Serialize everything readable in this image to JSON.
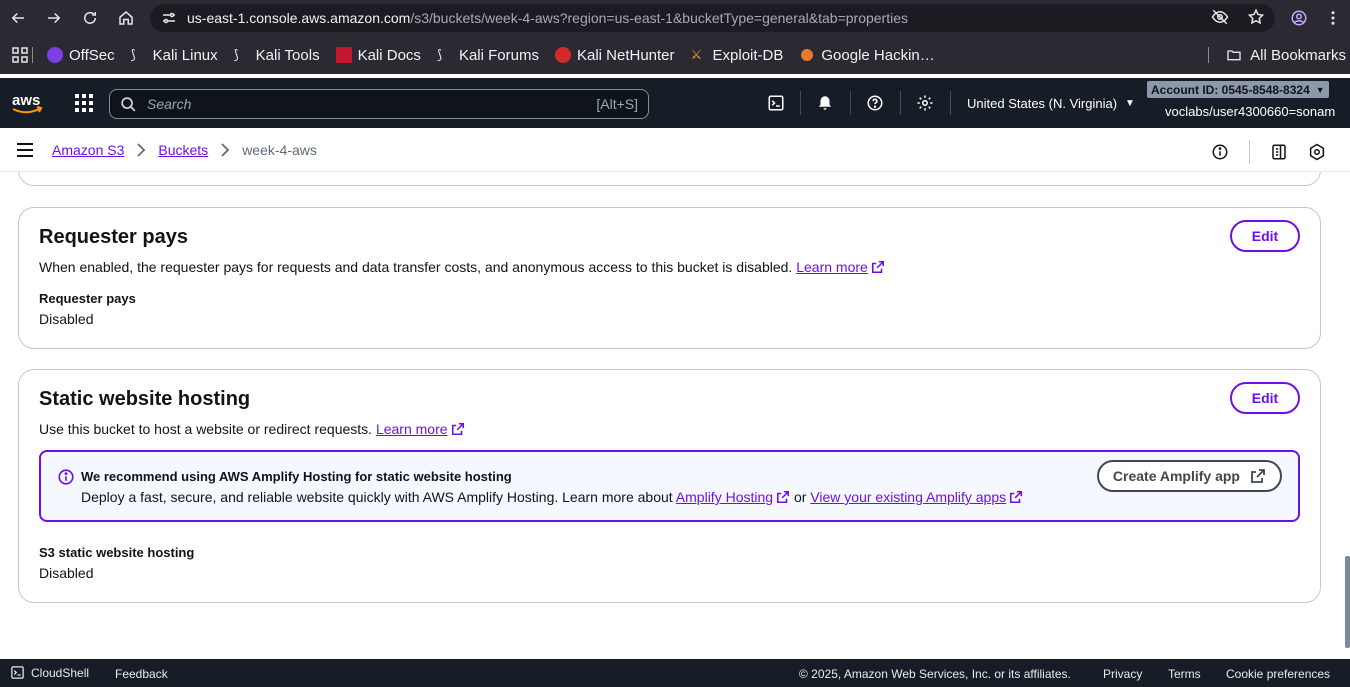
{
  "browser": {
    "url_host": "us-east-1.console.aws.amazon.com",
    "url_path": "/s3/buckets/week-4-aws?region=us-east-1&bucketType=general&tab=properties"
  },
  "bookmarks": {
    "items": [
      "OffSec",
      "Kali Linux",
      "Kali Tools",
      "Kali Docs",
      "Kali Forums",
      "Kali NetHunter",
      "Exploit-DB",
      "Google Hackin…"
    ],
    "all_label": "All Bookmarks"
  },
  "aws_header": {
    "logo_text": "aws",
    "search_placeholder": "Search",
    "search_shortcut": "[Alt+S]",
    "region": "United States (N. Virginia)",
    "account": "Account ID: 0545-8548-8324",
    "user": "voclabs/user4300660=sonam"
  },
  "breadcrumb": {
    "items": [
      "Amazon S3",
      "Buckets",
      "week-4-aws"
    ]
  },
  "requester_pays": {
    "title": "Requester pays",
    "description": "When enabled, the requester pays for requests and data transfer costs, and anonymous access to this bucket is disabled.",
    "learn_more": "Learn more",
    "edit_label": "Edit",
    "field_label": "Requester pays",
    "field_value": "Disabled"
  },
  "static_hosting": {
    "title": "Static website hosting",
    "description": "Use this bucket to host a website or redirect requests.",
    "learn_more": "Learn more",
    "edit_label": "Edit",
    "alert_title": "We recommend using AWS Amplify Hosting for static website hosting",
    "alert_body": "Deploy a fast, secure, and reliable website quickly with AWS Amplify Hosting. Learn more about",
    "alert_link1": "Amplify Hosting",
    "alert_or": "or",
    "alert_link2": "View your existing Amplify apps",
    "alert_button": "Create Amplify app",
    "field_label": "S3 static website hosting",
    "field_value": "Disabled"
  },
  "footer": {
    "cloudshell": "CloudShell",
    "feedback": "Feedback",
    "copyright": "© 2025, Amazon Web Services, Inc. or its affiliates.",
    "privacy": "Privacy",
    "terms": "Terms",
    "cookies": "Cookie preferences"
  },
  "colors": {
    "accent": "#6f0fe7",
    "header_bg": "#161d26",
    "browser_bg": "#2b2a33",
    "alert_bg": "#f5f9ff"
  }
}
